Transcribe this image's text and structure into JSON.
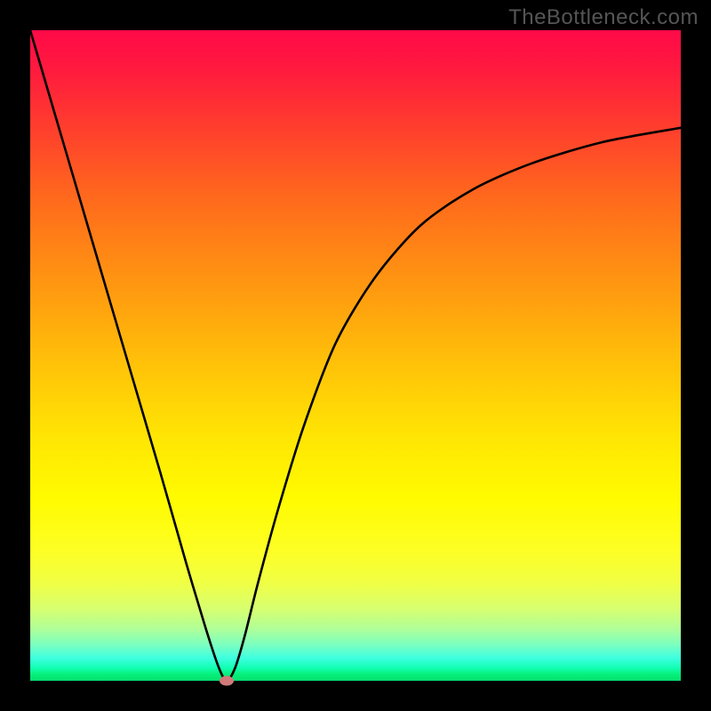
{
  "watermark": "TheBottleneck.com",
  "chart_data": {
    "type": "line",
    "title": "",
    "xlabel": "",
    "ylabel": "",
    "xlim": [
      0,
      100
    ],
    "ylim": [
      0,
      100
    ],
    "x": [
      0,
      5,
      10,
      15,
      20,
      24,
      27,
      29,
      30.2,
      31.5,
      33,
      35,
      38,
      42,
      47,
      53,
      60,
      68,
      77,
      88,
      100
    ],
    "values": [
      100,
      83,
      66,
      49,
      32,
      18,
      8,
      2,
      0,
      2,
      7,
      15,
      26,
      39,
      52,
      62,
      70,
      75.5,
      79.5,
      82.8,
      85
    ],
    "min_point": {
      "x": 30.2,
      "y": 0
    },
    "gradient_stops": [
      {
        "pos": 0,
        "color": "#ff0a48"
      },
      {
        "pos": 0.14,
        "color": "#ff3a2f"
      },
      {
        "pos": 0.4,
        "color": "#ff9a10"
      },
      {
        "pos": 0.72,
        "color": "#fffb00"
      },
      {
        "pos": 0.92,
        "color": "#b0ff98"
      },
      {
        "pos": 1.0,
        "color": "#06de6e"
      }
    ]
  },
  "colors": {
    "frame": "#000000",
    "curve": "#000000",
    "dot": "#d07a7a",
    "watermark": "#555555"
  }
}
